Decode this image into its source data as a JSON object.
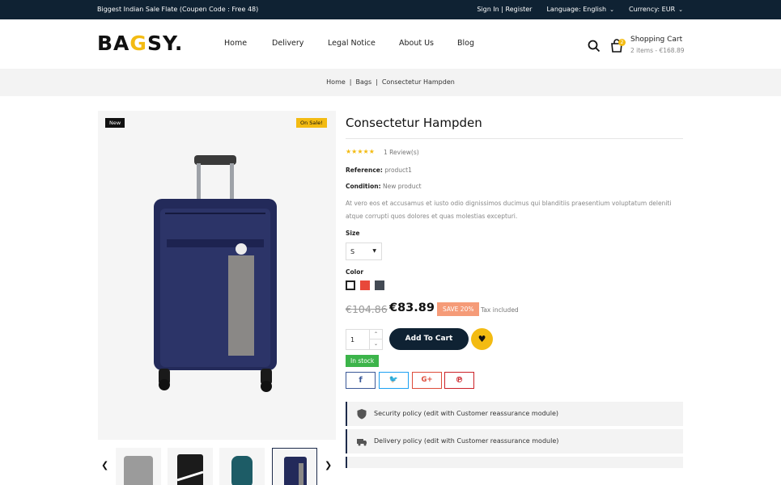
{
  "topbar": {
    "promo": "Biggest Indian Sale Flate (Coupen Code : Free 48)",
    "account": "Sign In | Register",
    "language": "Language: English",
    "currency": "Currency: EUR"
  },
  "logo": {
    "part1": "BA",
    "accent": "G",
    "part2": "SY."
  },
  "nav": {
    "items": [
      "Home",
      "Delivery",
      "Legal Notice",
      "About Us",
      "Blog"
    ]
  },
  "cart": {
    "title": "Shopping Cart",
    "summary": "2 items - €168.89",
    "count": "2"
  },
  "breadcrumb": {
    "items": [
      "Home",
      "Bags",
      "Consectetur Hampden"
    ],
    "separator": "|"
  },
  "gallery": {
    "badge_new": "New",
    "badge_sale": "On Sale!",
    "prev": "❮",
    "next": "❯"
  },
  "product": {
    "title": "Consectetur Hampden",
    "stars": "★★★★★",
    "reviews": "1 Review(s)",
    "reference_label": "Reference:",
    "reference": "product1",
    "condition_label": "Condition:",
    "condition": "New product",
    "description": "At vero eos et accusamus et iusto odio dignissimos ducimus qui blanditiis praesentium voluptatum deleniti atque corrupti quos dolores et quas molestias excepturi.",
    "size_label": "Size",
    "size_value": "S",
    "color_label": "Color",
    "colors": [
      "#ffffff",
      "#e8483a",
      "#434a54"
    ],
    "price_old": "€104.86",
    "price_new": "€83.89",
    "save": "SAVE 20%",
    "tax": "Tax included",
    "quantity": "1",
    "add_to_cart": "Add To Cart",
    "stock": "In stock"
  },
  "share": {
    "facebook": "f",
    "twitter": "🐦",
    "googleplus": "G+",
    "pinterest": "℗"
  },
  "policies": [
    "Security policy (edit with Customer reassurance module)",
    "Delivery policy (edit with Customer reassurance module)"
  ],
  "colors": {
    "dark": "#0f2233",
    "accent": "#f3bb12",
    "save": "#f59b78",
    "stock": "#3cb44a"
  }
}
